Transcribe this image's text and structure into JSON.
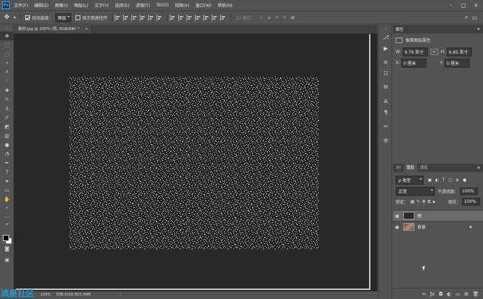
{
  "menu": [
    "文件(F)",
    "编辑(E)",
    "图像(I)",
    "图层(L)",
    "文字(Y)",
    "选择(S)",
    "滤镜(T)",
    "3D(D)",
    "视图(V)",
    "窗口(W)",
    "帮助(H)"
  ],
  "logo_text": "Ps",
  "options": {
    "auto_select_label": "自动选择：",
    "auto_select_value": "图层",
    "show_transform_label": "显示变换控件",
    "mode_3d_label": "3D 模式："
  },
  "document": {
    "tab_title": "素材.jpg @ 100% (雨, RGB/8#) *",
    "close_glyph": "×"
  },
  "status": {
    "zoom": "100%",
    "doc_info": "文档:1018.3K/1.99M"
  },
  "watermark": "流星社区",
  "properties": {
    "title": "属性",
    "subtitle": "像素图层属性",
    "w_label": "W:",
    "w_value": "9.79 英寸",
    "h_label": "H:",
    "h_value": "6.85 英寸",
    "x_label": "X:",
    "x_value": "0 厘米",
    "y_label": "Y:",
    "y_value": "0 厘米"
  },
  "layers_panel": {
    "tabs": [
      "3D",
      "图层",
      "通道"
    ],
    "active_tab": "图层",
    "kind_filter": "ρ 类型",
    "blend_mode": "正常",
    "opacity_label": "不透明度：",
    "opacity_value": "100%",
    "lock_label": "锁定：",
    "fill_label": "填充：",
    "fill_value": "100%",
    "layers": [
      {
        "name": "雨",
        "selected": true,
        "locked": false
      },
      {
        "name": "背景",
        "selected": false,
        "locked": true
      }
    ]
  },
  "colors": {
    "ui_bg": "#535353",
    "panel_dark": "#3f3f3f",
    "canvas_bg": "#282828",
    "accent": "#31a8ff"
  }
}
